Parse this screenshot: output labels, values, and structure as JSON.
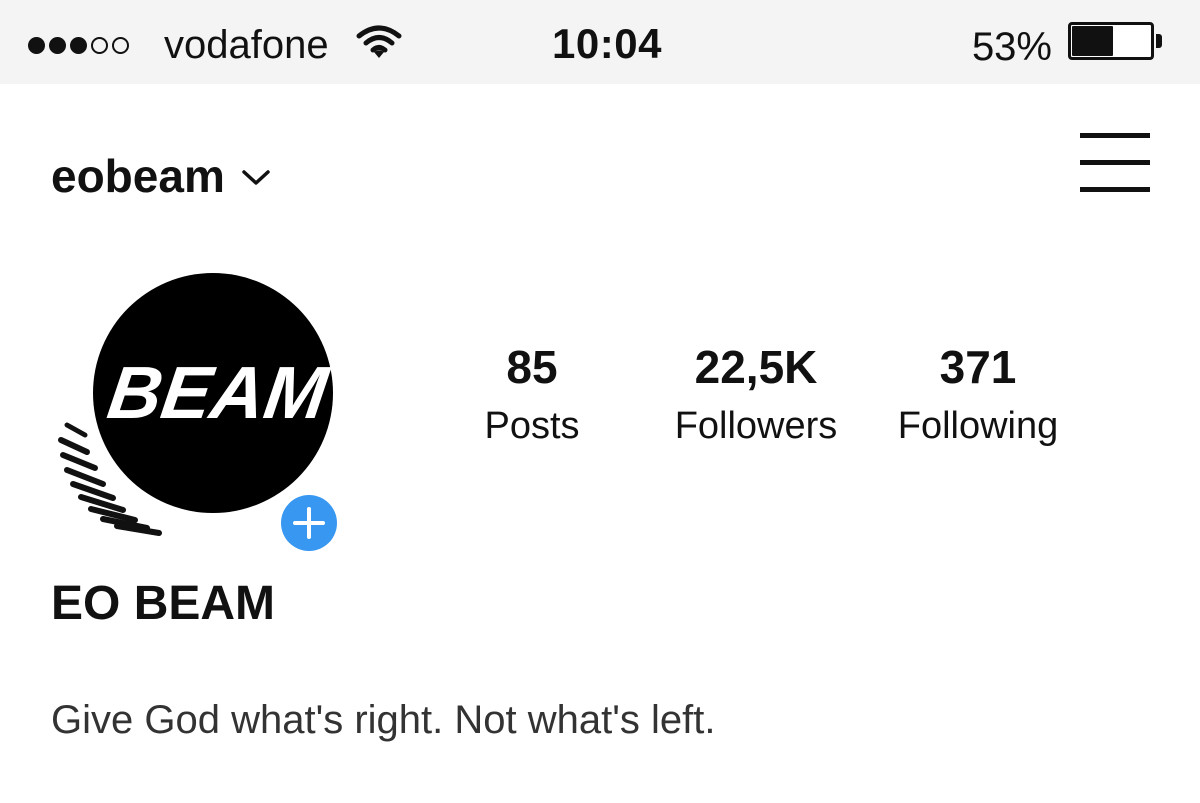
{
  "status_bar": {
    "signal_strength": 3,
    "signal_max": 5,
    "carrier": "vodafone",
    "wifi_icon": "wifi-icon",
    "time": "10:04",
    "battery_percent_text": "53%",
    "battery_level": 0.53
  },
  "header": {
    "username": "eobeam",
    "dropdown_icon": "chevron-down-icon",
    "menu_icon": "hamburger-menu-icon"
  },
  "profile": {
    "avatar_text": "BEAM",
    "add_story_icon": "plus-icon",
    "accent_color": "#3897f0",
    "stats": {
      "posts": {
        "value": "85",
        "label": "Posts"
      },
      "followers": {
        "value": "22,5K",
        "label": "Followers"
      },
      "following": {
        "value": "371",
        "label": "Following"
      }
    },
    "display_name": "EO BEAM",
    "bio": "Give God what's right. Not what's left."
  }
}
